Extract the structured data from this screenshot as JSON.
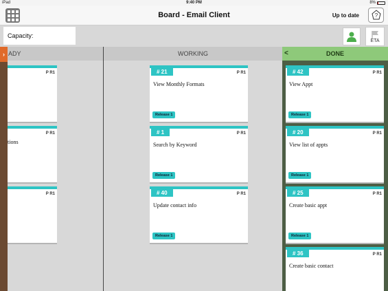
{
  "status_bar": {
    "device": "iPad",
    "time": "9:40 PM",
    "battery": "8%",
    "battery_level": 0.08
  },
  "header": {
    "title": "Board - Email Client",
    "sync_status": "Up to date"
  },
  "toolbar": {
    "capacity_label": "Capacity:",
    "eta_label": "ETA"
  },
  "columns": {
    "ready": {
      "label": "ADY"
    },
    "working": {
      "label": "WORKING"
    },
    "done": {
      "label": "DONE",
      "chevron": "<"
    }
  },
  "ready_cards": [
    {
      "priority": "P R1",
      "title": ""
    },
    {
      "priority": "P R1",
      "title": "tions"
    },
    {
      "priority": "P R1",
      "title": ""
    }
  ],
  "working_cards": [
    {
      "number": "# 21",
      "priority": "P R1",
      "title": "View Monthly Formats",
      "release": "Release 1"
    },
    {
      "number": "# 1",
      "priority": "P R1",
      "title": "Search by Keyword",
      "release": "Release 1"
    },
    {
      "number": "# 40",
      "priority": "P R1",
      "title": "Update contact info",
      "release": "Release 1"
    }
  ],
  "done_cards": [
    {
      "number": "# 42",
      "priority": "P R1",
      "title": "View Appt",
      "release": "Release 1"
    },
    {
      "number": "# 20",
      "priority": "P R1",
      "title": "View list of appts",
      "release": "Release 1"
    },
    {
      "number": "# 25",
      "priority": "P R1",
      "title": "Create basic appt",
      "release": "Release 1"
    },
    {
      "number": "# 36",
      "priority": "P R1",
      "title": "Create basic contact"
    }
  ],
  "colors": {
    "accent_teal": "#2ec4c4",
    "done_header": "#8ec97a",
    "done_background": "#4d5e45",
    "left_tab": "#e06a2a",
    "user_green": "#4cae4c"
  },
  "icons": [
    "app-grid-icon",
    "help-icon",
    "user-icon",
    "flag-icon",
    "collapse-left-icon",
    "chevron-left-icon"
  ]
}
